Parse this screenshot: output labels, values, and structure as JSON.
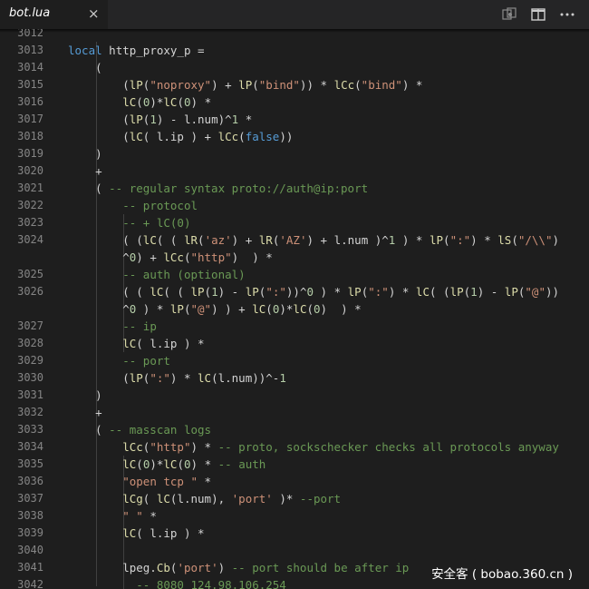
{
  "tab": {
    "title": "bot.lua",
    "close_glyph": "×"
  },
  "toolbar": {
    "icons": [
      "open-changes-icon",
      "split-editor-icon",
      "more-actions-icon"
    ]
  },
  "colors": {
    "keyword": "#569cd6",
    "function": "#dcdcaa",
    "string": "#ce9178",
    "comment": "#6a9955",
    "number": "#b5cea8",
    "text": "#d4d4d4"
  },
  "watermark": "安全客 ( bobao.360.cn )",
  "lines": [
    {
      "ln": "3012",
      "spans": []
    },
    {
      "ln": "3013",
      "spans": [
        [
          "k",
          "local"
        ],
        [
          "t",
          " http_proxy_p ="
        ]
      ]
    },
    {
      "ln": "3014",
      "spans": [
        [
          "t",
          "    ("
        ]
      ]
    },
    {
      "ln": "3015",
      "spans": [
        [
          "t",
          "        ("
        ],
        [
          "f",
          "lP"
        ],
        [
          "t",
          "("
        ],
        [
          "s",
          "\"noproxy\""
        ],
        [
          "t",
          ") + "
        ],
        [
          "f",
          "lP"
        ],
        [
          "t",
          "("
        ],
        [
          "s",
          "\"bind\""
        ],
        [
          "t",
          ")) * "
        ],
        [
          "f",
          "lCc"
        ],
        [
          "t",
          "("
        ],
        [
          "s",
          "\"bind\""
        ],
        [
          "t",
          ") *"
        ]
      ]
    },
    {
      "ln": "3016",
      "spans": [
        [
          "t",
          "        "
        ],
        [
          "f",
          "lC"
        ],
        [
          "t",
          "("
        ],
        [
          "n",
          "0"
        ],
        [
          "t",
          ")*"
        ],
        [
          "f",
          "lC"
        ],
        [
          "t",
          "("
        ],
        [
          "n",
          "0"
        ],
        [
          "t",
          ") *"
        ]
      ]
    },
    {
      "ln": "3017",
      "spans": [
        [
          "t",
          "        ("
        ],
        [
          "f",
          "lP"
        ],
        [
          "t",
          "("
        ],
        [
          "n",
          "1"
        ],
        [
          "t",
          ") - l.num)^"
        ],
        [
          "n",
          "1"
        ],
        [
          "t",
          " *"
        ]
      ]
    },
    {
      "ln": "3018",
      "spans": [
        [
          "t",
          "        ("
        ],
        [
          "f",
          "lC"
        ],
        [
          "t",
          "( l.ip ) + "
        ],
        [
          "f",
          "lCc"
        ],
        [
          "t",
          "("
        ],
        [
          "k",
          "false"
        ],
        [
          "t",
          "))"
        ]
      ]
    },
    {
      "ln": "3019",
      "spans": [
        [
          "t",
          "    )"
        ]
      ]
    },
    {
      "ln": "3020",
      "spans": [
        [
          "t",
          "    +"
        ]
      ]
    },
    {
      "ln": "3021",
      "spans": [
        [
          "t",
          "    ( "
        ],
        [
          "c",
          "-- regular syntax proto://auth@ip:port"
        ]
      ]
    },
    {
      "ln": "3022",
      "spans": [
        [
          "t",
          "        "
        ],
        [
          "c",
          "-- protocol"
        ]
      ]
    },
    {
      "ln": "3023",
      "spans": [
        [
          "t",
          "        "
        ],
        [
          "c",
          "-- + lC(0)"
        ]
      ]
    },
    {
      "ln": "3024",
      "spans": [
        [
          "t",
          "        ( ("
        ],
        [
          "f",
          "lC"
        ],
        [
          "t",
          "( ( "
        ],
        [
          "f",
          "lR"
        ],
        [
          "t",
          "("
        ],
        [
          "s",
          "'az'"
        ],
        [
          "t",
          ") + "
        ],
        [
          "f",
          "lR"
        ],
        [
          "t",
          "("
        ],
        [
          "s",
          "'AZ'"
        ],
        [
          "t",
          ") + l.num )^"
        ],
        [
          "n",
          "1"
        ],
        [
          "t",
          " ) * "
        ],
        [
          "f",
          "lP"
        ],
        [
          "t",
          "("
        ],
        [
          "s",
          "\":\""
        ],
        [
          "t",
          ") * "
        ],
        [
          "f",
          "lS"
        ],
        [
          "t",
          "("
        ],
        [
          "s",
          "\"/\\\\\""
        ],
        [
          "t",
          ")"
        ]
      ]
    },
    {
      "ln": "",
      "spans": [
        [
          "t",
          "        ^"
        ],
        [
          "n",
          "0"
        ],
        [
          "t",
          ") + "
        ],
        [
          "f",
          "lCc"
        ],
        [
          "t",
          "("
        ],
        [
          "s",
          "\"http\""
        ],
        [
          "t",
          ")  ) *"
        ]
      ]
    },
    {
      "ln": "3025",
      "spans": [
        [
          "t",
          "        "
        ],
        [
          "c",
          "-- auth (optional)"
        ]
      ]
    },
    {
      "ln": "3026",
      "spans": [
        [
          "t",
          "        ( ( "
        ],
        [
          "f",
          "lC"
        ],
        [
          "t",
          "( ( "
        ],
        [
          "f",
          "lP"
        ],
        [
          "t",
          "("
        ],
        [
          "n",
          "1"
        ],
        [
          "t",
          ") - "
        ],
        [
          "f",
          "lP"
        ],
        [
          "t",
          "("
        ],
        [
          "s",
          "\":\""
        ],
        [
          "t",
          "))^"
        ],
        [
          "n",
          "0"
        ],
        [
          "t",
          " ) * "
        ],
        [
          "f",
          "lP"
        ],
        [
          "t",
          "("
        ],
        [
          "s",
          "\":\""
        ],
        [
          "t",
          ") * "
        ],
        [
          "f",
          "lC"
        ],
        [
          "t",
          "( ("
        ],
        [
          "f",
          "lP"
        ],
        [
          "t",
          "("
        ],
        [
          "n",
          "1"
        ],
        [
          "t",
          ") - "
        ],
        [
          "f",
          "lP"
        ],
        [
          "t",
          "("
        ],
        [
          "s",
          "\"@\""
        ],
        [
          "t",
          "))"
        ]
      ]
    },
    {
      "ln": "",
      "spans": [
        [
          "t",
          "        ^"
        ],
        [
          "n",
          "0"
        ],
        [
          "t",
          " ) * "
        ],
        [
          "f",
          "lP"
        ],
        [
          "t",
          "("
        ],
        [
          "s",
          "\"@\""
        ],
        [
          "t",
          ") ) + "
        ],
        [
          "f",
          "lC"
        ],
        [
          "t",
          "("
        ],
        [
          "n",
          "0"
        ],
        [
          "t",
          ")*"
        ],
        [
          "f",
          "lC"
        ],
        [
          "t",
          "("
        ],
        [
          "n",
          "0"
        ],
        [
          "t",
          ")  ) *"
        ]
      ]
    },
    {
      "ln": "3027",
      "spans": [
        [
          "t",
          "        "
        ],
        [
          "c",
          "-- ip"
        ]
      ]
    },
    {
      "ln": "3028",
      "spans": [
        [
          "t",
          "        "
        ],
        [
          "f",
          "lC"
        ],
        [
          "t",
          "( l.ip ) *"
        ]
      ]
    },
    {
      "ln": "3029",
      "spans": [
        [
          "t",
          "        "
        ],
        [
          "c",
          "-- port"
        ]
      ]
    },
    {
      "ln": "3030",
      "spans": [
        [
          "t",
          "        ("
        ],
        [
          "f",
          "lP"
        ],
        [
          "t",
          "("
        ],
        [
          "s",
          "\":\""
        ],
        [
          "t",
          ") * "
        ],
        [
          "f",
          "lC"
        ],
        [
          "t",
          "(l.num))^-"
        ],
        [
          "n",
          "1"
        ]
      ]
    },
    {
      "ln": "3031",
      "spans": [
        [
          "t",
          "    )"
        ]
      ]
    },
    {
      "ln": "3032",
      "spans": [
        [
          "t",
          "    +"
        ]
      ]
    },
    {
      "ln": "3033",
      "spans": [
        [
          "t",
          "    ( "
        ],
        [
          "c",
          "-- masscan logs"
        ]
      ]
    },
    {
      "ln": "3034",
      "spans": [
        [
          "t",
          "        "
        ],
        [
          "f",
          "lCc"
        ],
        [
          "t",
          "("
        ],
        [
          "s",
          "\"http\""
        ],
        [
          "t",
          ") * "
        ],
        [
          "c",
          "-- proto, sockschecker checks all protocols anyway"
        ]
      ]
    },
    {
      "ln": "3035",
      "spans": [
        [
          "t",
          "        "
        ],
        [
          "f",
          "lC"
        ],
        [
          "t",
          "("
        ],
        [
          "n",
          "0"
        ],
        [
          "t",
          ")*"
        ],
        [
          "f",
          "lC"
        ],
        [
          "t",
          "("
        ],
        [
          "n",
          "0"
        ],
        [
          "t",
          ") * "
        ],
        [
          "c",
          "-- auth"
        ]
      ]
    },
    {
      "ln": "3036",
      "spans": [
        [
          "t",
          "        "
        ],
        [
          "s",
          "\"open tcp \""
        ],
        [
          "t",
          " *"
        ]
      ]
    },
    {
      "ln": "3037",
      "spans": [
        [
          "t",
          "        "
        ],
        [
          "f",
          "lCg"
        ],
        [
          "t",
          "( "
        ],
        [
          "f",
          "lC"
        ],
        [
          "t",
          "(l.num), "
        ],
        [
          "s",
          "'port'"
        ],
        [
          "t",
          " )* "
        ],
        [
          "c",
          "--port"
        ]
      ]
    },
    {
      "ln": "3038",
      "spans": [
        [
          "t",
          "        "
        ],
        [
          "s",
          "\" \""
        ],
        [
          "t",
          " *"
        ]
      ]
    },
    {
      "ln": "3039",
      "spans": [
        [
          "t",
          "        "
        ],
        [
          "f",
          "lC"
        ],
        [
          "t",
          "( l.ip ) *"
        ]
      ]
    },
    {
      "ln": "3040",
      "spans": []
    },
    {
      "ln": "3041",
      "spans": [
        [
          "t",
          "        lpeg."
        ],
        [
          "f",
          "Cb"
        ],
        [
          "t",
          "("
        ],
        [
          "s",
          "'port'"
        ],
        [
          "t",
          ") "
        ],
        [
          "c",
          "-- port should be after ip"
        ]
      ]
    },
    {
      "ln": "3042",
      "spans": [
        [
          "t",
          "          "
        ],
        [
          "c",
          "-- 8080 124.98.106.254"
        ]
      ]
    }
  ]
}
